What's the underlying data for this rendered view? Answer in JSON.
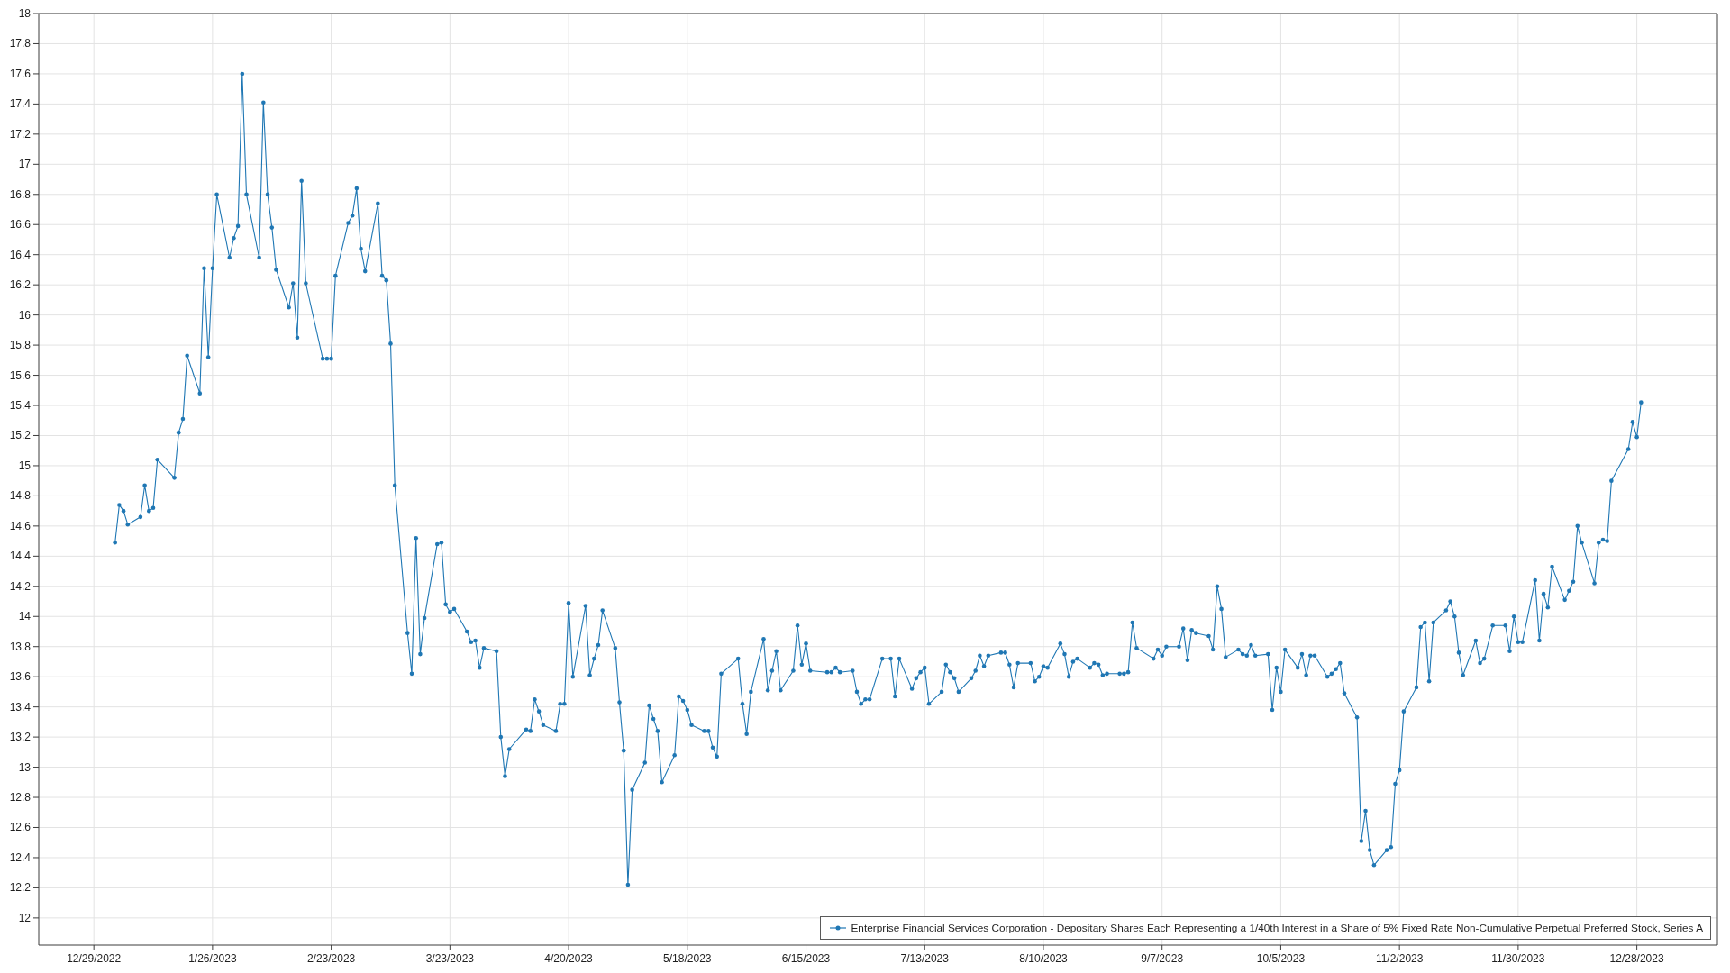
{
  "chart": {
    "chart_data": {
      "type": "line",
      "x": [
        "2023-01-03",
        "2023-01-04",
        "2023-01-05",
        "2023-01-06",
        "2023-01-09",
        "2023-01-10",
        "2023-01-11",
        "2023-01-12",
        "2023-01-13",
        "2023-01-17",
        "2023-01-18",
        "2023-01-19",
        "2023-01-20",
        "2023-01-23",
        "2023-01-24",
        "2023-01-25",
        "2023-01-26",
        "2023-01-27",
        "2023-01-30",
        "2023-01-31",
        "2023-02-01",
        "2023-02-02",
        "2023-02-03",
        "2023-02-06",
        "2023-02-07",
        "2023-02-08",
        "2023-02-09",
        "2023-02-10",
        "2023-02-13",
        "2023-02-14",
        "2023-02-15",
        "2023-02-16",
        "2023-02-17",
        "2023-02-21",
        "2023-02-22",
        "2023-02-23",
        "2023-02-24",
        "2023-02-27",
        "2023-02-28",
        "2023-03-01",
        "2023-03-02",
        "2023-03-03",
        "2023-03-06",
        "2023-03-07",
        "2023-03-08",
        "2023-03-09",
        "2023-03-10",
        "2023-03-13",
        "2023-03-14",
        "2023-03-15",
        "2023-03-16",
        "2023-03-17",
        "2023-03-20",
        "2023-03-21",
        "2023-03-22",
        "2023-03-23",
        "2023-03-24",
        "2023-03-27",
        "2023-03-28",
        "2023-03-29",
        "2023-03-30",
        "2023-03-31",
        "2023-04-03",
        "2023-04-04",
        "2023-04-05",
        "2023-04-06",
        "2023-04-10",
        "2023-04-11",
        "2023-04-12",
        "2023-04-13",
        "2023-04-14",
        "2023-04-17",
        "2023-04-18",
        "2023-04-19",
        "2023-04-20",
        "2023-04-21",
        "2023-04-24",
        "2023-04-25",
        "2023-04-26",
        "2023-04-27",
        "2023-04-28",
        "2023-05-01",
        "2023-05-02",
        "2023-05-03",
        "2023-05-04",
        "2023-05-05",
        "2023-05-08",
        "2023-05-09",
        "2023-05-10",
        "2023-05-11",
        "2023-05-12",
        "2023-05-15",
        "2023-05-16",
        "2023-05-17",
        "2023-05-18",
        "2023-05-19",
        "2023-05-22",
        "2023-05-23",
        "2023-05-24",
        "2023-05-25",
        "2023-05-26",
        "2023-05-30",
        "2023-05-31",
        "2023-06-01",
        "2023-06-02",
        "2023-06-05",
        "2023-06-06",
        "2023-06-07",
        "2023-06-08",
        "2023-06-09",
        "2023-06-12",
        "2023-06-13",
        "2023-06-14",
        "2023-06-15",
        "2023-06-16",
        "2023-06-20",
        "2023-06-21",
        "2023-06-22",
        "2023-06-23",
        "2023-06-26",
        "2023-06-27",
        "2023-06-28",
        "2023-06-29",
        "2023-06-30",
        "2023-07-03",
        "2023-07-05",
        "2023-07-06",
        "2023-07-07",
        "2023-07-10",
        "2023-07-11",
        "2023-07-12",
        "2023-07-13",
        "2023-07-14",
        "2023-07-17",
        "2023-07-18",
        "2023-07-19",
        "2023-07-20",
        "2023-07-21",
        "2023-07-24",
        "2023-07-25",
        "2023-07-26",
        "2023-07-27",
        "2023-07-28",
        "2023-07-31",
        "2023-08-01",
        "2023-08-02",
        "2023-08-03",
        "2023-08-04",
        "2023-08-07",
        "2023-08-08",
        "2023-08-09",
        "2023-08-10",
        "2023-08-11",
        "2023-08-14",
        "2023-08-15",
        "2023-08-16",
        "2023-08-17",
        "2023-08-18",
        "2023-08-21",
        "2023-08-22",
        "2023-08-23",
        "2023-08-24",
        "2023-08-25",
        "2023-08-28",
        "2023-08-29",
        "2023-08-30",
        "2023-08-31",
        "2023-09-01",
        "2023-09-05",
        "2023-09-06",
        "2023-09-07",
        "2023-09-08",
        "2023-09-11",
        "2023-09-12",
        "2023-09-13",
        "2023-09-14",
        "2023-09-15",
        "2023-09-18",
        "2023-09-19",
        "2023-09-20",
        "2023-09-21",
        "2023-09-22",
        "2023-09-25",
        "2023-09-26",
        "2023-09-27",
        "2023-09-28",
        "2023-09-29",
        "2023-10-02",
        "2023-10-03",
        "2023-10-04",
        "2023-10-05",
        "2023-10-06",
        "2023-10-09",
        "2023-10-10",
        "2023-10-11",
        "2023-10-12",
        "2023-10-13",
        "2023-10-16",
        "2023-10-17",
        "2023-10-18",
        "2023-10-19",
        "2023-10-20",
        "2023-10-23",
        "2023-10-24",
        "2023-10-25",
        "2023-10-26",
        "2023-10-27",
        "2023-10-30",
        "2023-10-31",
        "2023-11-01",
        "2023-11-02",
        "2023-11-03",
        "2023-11-06",
        "2023-11-07",
        "2023-11-08",
        "2023-11-09",
        "2023-11-10",
        "2023-11-13",
        "2023-11-14",
        "2023-11-15",
        "2023-11-16",
        "2023-11-17",
        "2023-11-20",
        "2023-11-21",
        "2023-11-22",
        "2023-11-24",
        "2023-11-27",
        "2023-11-28",
        "2023-11-29",
        "2023-11-30",
        "2023-12-01",
        "2023-12-04",
        "2023-12-05",
        "2023-12-06",
        "2023-12-07",
        "2023-12-08",
        "2023-12-11",
        "2023-12-12",
        "2023-12-13",
        "2023-12-14",
        "2023-12-15",
        "2023-12-18",
        "2023-12-19",
        "2023-12-20",
        "2023-12-21",
        "2023-12-22",
        "2023-12-26",
        "2023-12-27",
        "2023-12-28",
        "2023-12-29"
      ],
      "series": [
        {
          "name": "Enterprise Financial Services Corporation - Depositary Shares Each Representing a 1/40th Interest in a Share of 5% Fixed Rate Non-Cumulative Perpetual Preferred Stock, Series A",
          "color": "#1f77b4",
          "values": [
            14.49,
            14.74,
            14.7,
            14.61,
            14.66,
            14.87,
            14.7,
            14.72,
            15.04,
            14.92,
            15.22,
            15.31,
            15.73,
            15.48,
            16.31,
            15.72,
            16.31,
            16.8,
            16.38,
            16.51,
            16.59,
            17.6,
            16.8,
            16.38,
            17.41,
            16.8,
            16.58,
            16.3,
            16.05,
            16.21,
            15.85,
            16.89,
            16.21,
            15.71,
            15.71,
            15.71,
            16.26,
            16.61,
            16.66,
            16.84,
            16.44,
            16.29,
            16.74,
            16.26,
            16.23,
            15.81,
            14.87,
            13.89,
            13.62,
            14.52,
            13.75,
            13.99,
            14.48,
            14.49,
            14.08,
            14.03,
            14.05,
            13.9,
            13.83,
            13.84,
            13.66,
            13.79,
            13.77,
            13.2,
            12.94,
            13.12,
            13.25,
            13.24,
            13.45,
            13.37,
            13.28,
            13.24,
            13.42,
            13.42,
            14.09,
            13.6,
            14.07,
            13.61,
            13.72,
            13.81,
            14.04,
            13.79,
            13.43,
            13.11,
            12.22,
            12.85,
            13.03,
            13.41,
            13.32,
            13.24,
            12.9,
            13.08,
            13.47,
            13.44,
            13.38,
            13.28,
            13.24,
            13.24,
            13.13,
            13.07,
            13.62,
            13.72,
            13.42,
            13.22,
            13.5,
            13.85,
            13.51,
            13.64,
            13.77,
            13.51,
            13.64,
            13.94,
            13.68,
            13.82,
            13.64,
            13.63,
            13.63,
            13.66,
            13.63,
            13.64,
            13.5,
            13.42,
            13.45,
            13.45,
            13.72,
            13.72,
            13.47,
            13.72,
            13.52,
            13.59,
            13.63,
            13.66,
            13.42,
            13.5,
            13.68,
            13.63,
            13.59,
            13.5,
            13.59,
            13.64,
            13.74,
            13.67,
            13.74,
            13.76,
            13.76,
            13.68,
            13.53,
            13.69,
            13.69,
            13.57,
            13.6,
            13.67,
            13.66,
            13.82,
            13.75,
            13.6,
            13.7,
            13.72,
            13.66,
            13.69,
            13.68,
            13.61,
            13.62,
            13.62,
            13.62,
            13.63,
            13.96,
            13.79,
            13.72,
            13.78,
            13.74,
            13.8,
            13.8,
            13.92,
            13.71,
            13.91,
            13.89,
            13.87,
            13.78,
            14.2,
            14.05,
            13.73,
            13.78,
            13.75,
            13.74,
            13.81,
            13.74,
            13.75,
            13.38,
            13.66,
            13.5,
            13.78,
            13.66,
            13.75,
            13.61,
            13.74,
            13.74,
            13.6,
            13.62,
            13.65,
            13.69,
            13.49,
            13.33,
            12.51,
            12.71,
            12.45,
            12.35,
            12.45,
            12.47,
            12.89,
            12.98,
            13.37,
            13.53,
            13.93,
            13.96,
            13.57,
            13.96,
            14.04,
            14.1,
            14.0,
            13.76,
            13.61,
            13.84,
            13.69,
            13.72,
            13.94,
            13.94,
            13.77,
            14.0,
            13.83,
            13.83,
            14.24,
            13.84,
            14.15,
            14.06,
            14.33,
            14.11,
            14.17,
            14.23,
            14.6,
            14.49,
            14.22,
            14.49,
            14.51,
            14.5,
            14.9,
            15.11,
            15.29,
            15.19,
            15.42
          ]
        }
      ],
      "xlim": [
        "2022-12-16",
        "2024-01-16"
      ],
      "ylim": [
        11.82,
        18
      ],
      "grid": true,
      "xticks": [
        {
          "value": "2022-12-29",
          "label": "12/29/2022"
        },
        {
          "value": "2023-01-26",
          "label": "1/26/2023"
        },
        {
          "value": "2023-02-23",
          "label": "2/23/2023"
        },
        {
          "value": "2023-03-23",
          "label": "3/23/2023"
        },
        {
          "value": "2023-04-20",
          "label": "4/20/2023"
        },
        {
          "value": "2023-05-18",
          "label": "5/18/2023"
        },
        {
          "value": "2023-06-15",
          "label": "6/15/2023"
        },
        {
          "value": "2023-07-13",
          "label": "7/13/2023"
        },
        {
          "value": "2023-08-10",
          "label": "8/10/2023"
        },
        {
          "value": "2023-09-07",
          "label": "9/7/2023"
        },
        {
          "value": "2023-10-05",
          "label": "10/5/2023"
        },
        {
          "value": "2023-11-02",
          "label": "11/2/2023"
        },
        {
          "value": "2023-11-30",
          "label": "11/30/2023"
        },
        {
          "value": "2023-12-28",
          "label": "12/28/2023"
        }
      ],
      "yticks": [
        12,
        12.2,
        12.4,
        12.6,
        12.8,
        13,
        13.2,
        13.4,
        13.6,
        13.8,
        14,
        14.2,
        14.4,
        14.6,
        14.8,
        15,
        15.2,
        15.4,
        15.6,
        15.8,
        16,
        16.2,
        16.4,
        16.6,
        16.8,
        17,
        17.2,
        17.4,
        17.6,
        17.8,
        18
      ]
    }
  }
}
